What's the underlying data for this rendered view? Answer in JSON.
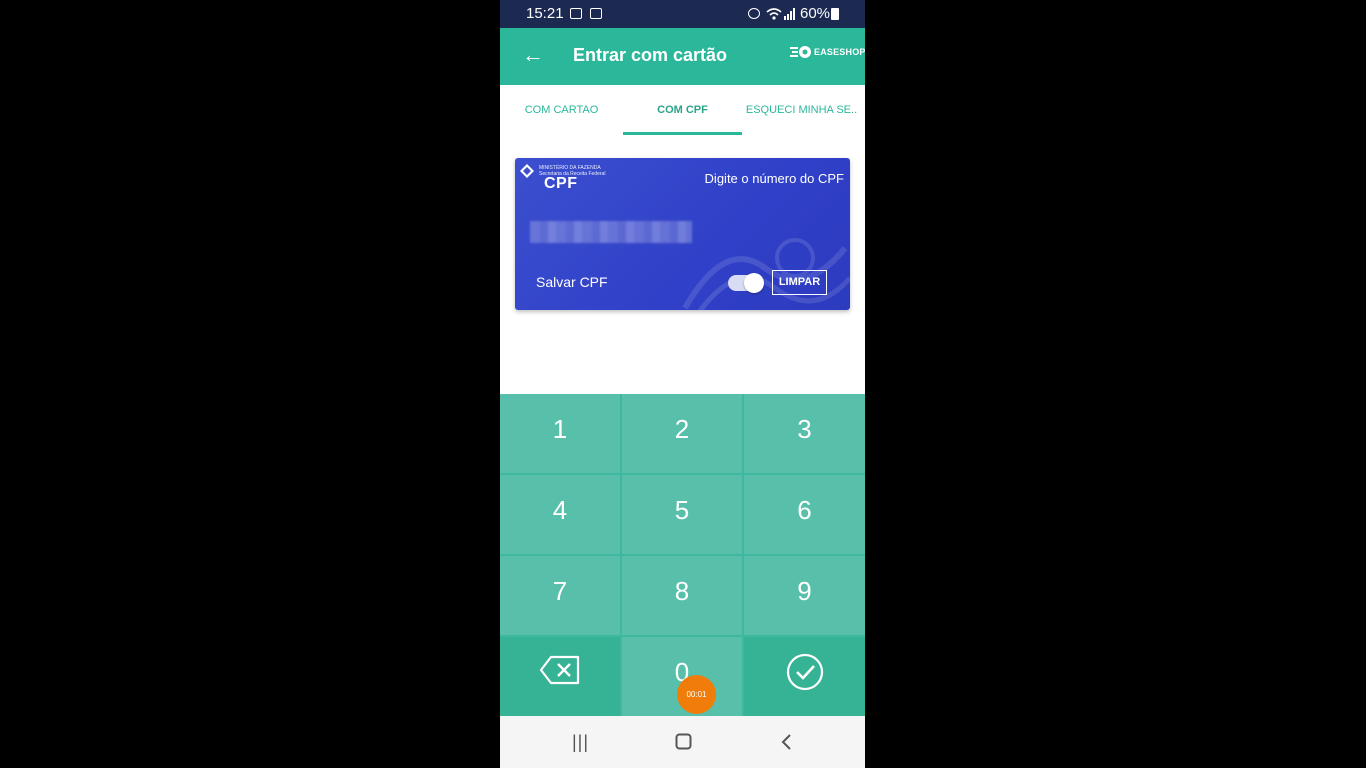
{
  "status_bar": {
    "time": "15:21",
    "battery": "60%"
  },
  "app_bar": {
    "back_icon": "arrow-left-icon",
    "title": "Entrar com cartão",
    "brand": "EASESHOPP"
  },
  "tabs": [
    {
      "label": "COM CARTAO",
      "active": false
    },
    {
      "label": "COM CPF",
      "active": true
    },
    {
      "label": "ESQUECI MINHA SE..",
      "active": false
    }
  ],
  "card": {
    "ministry_line1": "MINISTÉRIO DA FAZENDA",
    "ministry_line2": "Secretaria da Receita Federal",
    "cpf_logo": "CPF",
    "hint": "Digite o número do CPF",
    "number_masked": "",
    "save_label": "Salvar CPF",
    "save_toggle_on": true,
    "clear_button": "LIMPAR",
    "color": "#3b4fcf"
  },
  "keypad": {
    "keys": [
      "1",
      "2",
      "3",
      "4",
      "5",
      "6",
      "7",
      "8",
      "9"
    ],
    "zero": "0",
    "backspace_icon": "backspace-icon",
    "confirm_icon": "check-circle-icon",
    "accent": "#2bb89a"
  },
  "recording_badge": "00:01",
  "nav": {
    "recents": "|||",
    "home": "home-icon",
    "back": "chevron-left-icon"
  }
}
